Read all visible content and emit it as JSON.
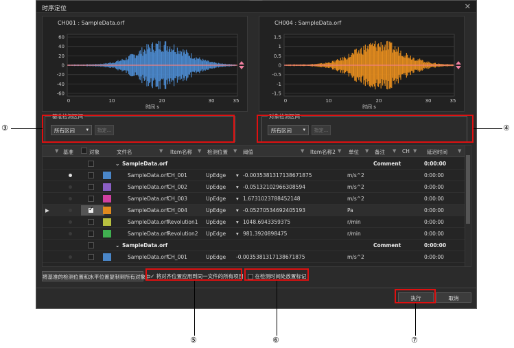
{
  "window": {
    "title": "时序定位"
  },
  "charts": [
    {
      "title": "CH001 : SampleData.orf",
      "color": "#4a86c8",
      "yticks": [
        "60",
        "40",
        "20",
        "0",
        "-20",
        "-40",
        "-60"
      ],
      "xticks": [
        "0",
        "10",
        "20",
        "30",
        "35"
      ],
      "xlabel": "时间 s"
    },
    {
      "title": "CH004 : SampleData.orf",
      "color": "#e08a1e",
      "yticks": [
        "1.5",
        "1",
        "0.5",
        "0",
        "-0.5",
        "-1",
        "-1.5"
      ],
      "xticks": [
        "0",
        "10",
        "20",
        "30",
        "35"
      ],
      "xlabel": "时间 s"
    }
  ],
  "ranges": [
    {
      "legend": "基准检测区间",
      "select": "所有区间",
      "button": "指定..."
    },
    {
      "legend": "对象检测区间",
      "select": "所有区间",
      "button": "指定..."
    }
  ],
  "grid": {
    "headers": {
      "base": "基准",
      "target": "对象",
      "file": "文件名",
      "item": "Item名称",
      "position": "检测位置",
      "threshold": "阈值",
      "item2": "Item名称2",
      "unit": "单位",
      "note": "备注",
      "ch": "CH",
      "delay": "延迟时间"
    },
    "group1": {
      "name": "SampleData.orf",
      "note": "Comment",
      "delay": "0:00:00"
    },
    "rows": [
      {
        "file": "SampleData.orf",
        "item": "CH_001",
        "pos": "UpEdge",
        "thr": "-0.0035381317138671875",
        "unit": "m/s^2",
        "delay": "0:00:00",
        "color": "#4a86c8"
      },
      {
        "file": "SampleData.orf",
        "item": "CH_002",
        "pos": "UpEdge",
        "thr": "-0.05132102966308594",
        "unit": "m/s^2",
        "delay": "0:00:00",
        "color": "#8b5fc4"
      },
      {
        "file": "SampleData.orf",
        "item": "CH_003",
        "pos": "UpEdge",
        "thr": "1.6731023788452148",
        "unit": "m/s^2",
        "delay": "0:00:00",
        "color": "#d040a0"
      },
      {
        "file": "SampleData.orf",
        "item": "CH_004",
        "pos": "UpEdge",
        "thr": "-0.05270534692405193",
        "unit": "Pa",
        "delay": "0:00:00",
        "color": "#e08a1e"
      },
      {
        "file": "SampleData.orf",
        "item": "Revolution1",
        "pos": "UpEdge",
        "thr": "1048.6943359375",
        "unit": "r/min",
        "delay": "0:00:00",
        "color": "#b8c040"
      },
      {
        "file": "SampleData.orf",
        "item": "Revolution2",
        "pos": "UpEdge",
        "thr": "981.3920898475",
        "unit": "r/min",
        "delay": "0:00:00",
        "color": "#40b050"
      }
    ],
    "group2": {
      "name": "SampleData.orf",
      "note": "Comment",
      "delay": "0:00:00"
    },
    "row7": {
      "file": "SampleData.orf",
      "item": "CH_001",
      "pos": "UpEdge",
      "thr": "-0.0035381317138671875",
      "unit": "m/s^2",
      "delay": "0:00:00",
      "color": "#4a86c8"
    }
  },
  "footer": {
    "apply_button": "将基准的检测位置和水平位置复制到所有对象中",
    "check_all_items": "将对齐位置应用到同一文件的所有项目",
    "check_record": "在检测时间处放置标记",
    "run_button": "执行",
    "cancel_button": "取消"
  },
  "callouts": [
    "③",
    "④",
    "⑤",
    "⑥",
    "⑦"
  ]
}
